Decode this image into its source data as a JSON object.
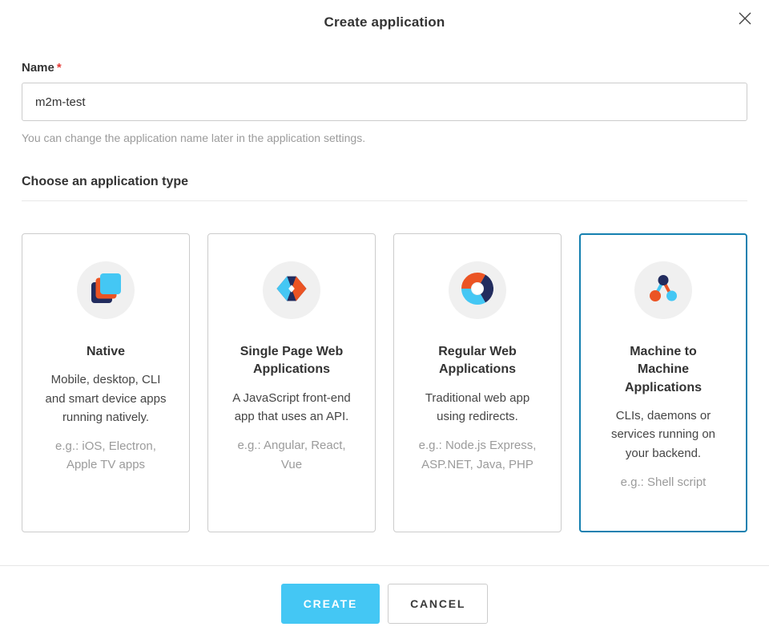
{
  "modal": {
    "title": "Create application"
  },
  "form": {
    "name_label": "Name",
    "required_marker": "*",
    "name_value": "m2m-test",
    "help_text": "You can change the application name later in the application settings."
  },
  "section": {
    "heading": "Choose an application type"
  },
  "cards": [
    {
      "title": "Native",
      "description": "Mobile, desktop, CLI and smart device apps running natively.",
      "example": "e.g.: iOS, Electron, Apple TV apps",
      "icon": "stacked-squares-icon",
      "selected": false
    },
    {
      "title": "Single Page Web Applications",
      "description": "A JavaScript front-end app that uses an API.",
      "example": "e.g.: Angular, React, Vue",
      "icon": "diamond-chevrons-icon",
      "selected": false
    },
    {
      "title": "Regular Web Applications",
      "description": "Traditional web app using redirects.",
      "example": "e.g.: Node.js Express, ASP.NET, Java, PHP",
      "icon": "segmented-ring-icon",
      "selected": false
    },
    {
      "title": "Machine to Machine Applications",
      "description": "CLIs, daemons or services running on your backend.",
      "example": "e.g.: Shell script",
      "icon": "network-nodes-icon",
      "selected": true
    }
  ],
  "footer": {
    "create_label": "CREATE",
    "cancel_label": "CANCEL"
  },
  "colors": {
    "accent_blue": "#44c7f4",
    "selected_card_border": "#1580b0",
    "brand_navy": "#222c5e",
    "brand_orange": "#eb5424",
    "required_red": "#e53935",
    "icon_circle_gray": "#f0f0f0"
  }
}
